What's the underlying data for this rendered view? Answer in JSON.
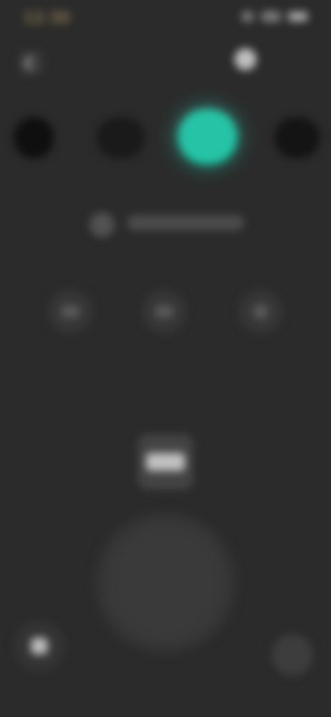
{
  "status": {
    "time": "12:30",
    "indicators": [
      "signal",
      "wifi",
      "battery"
    ]
  },
  "header": {
    "back_icon": "chevron-left-icon",
    "title": "",
    "settings_label": ""
  },
  "modes": [
    {
      "icon": "mode-icon",
      "selected": false
    },
    {
      "icon": "mode-icon",
      "selected": false
    },
    {
      "icon": "mode-icon",
      "selected": true,
      "accent": "#25c4a6"
    },
    {
      "icon": "mode-icon",
      "selected": false
    }
  ],
  "connection": {
    "label": ""
  },
  "quick_actions": [
    {
      "icon": "keyboard-icon"
    },
    {
      "icon": "dpad-icon"
    },
    {
      "icon": "circle-icon"
    }
  ],
  "controls": {
    "pad_icon": "touchpad-icon",
    "circle": "joystick",
    "left": "home-icon",
    "right": "menu-icon"
  },
  "colors": {
    "background": "#2b2b2b",
    "accent": "#25c4a6"
  }
}
